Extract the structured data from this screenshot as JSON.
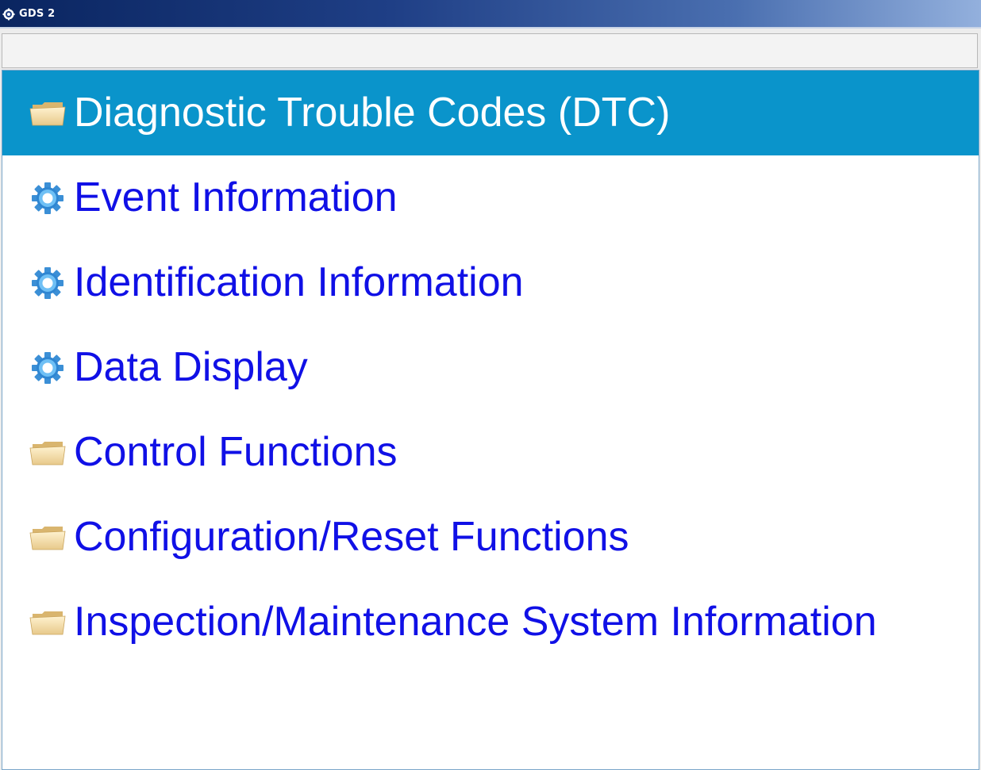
{
  "window": {
    "title": "GDS 2",
    "icon": "gds-app-icon"
  },
  "colors": {
    "selected_background": "#0a94cb",
    "item_text": "#1010e6",
    "selected_text": "#ffffff"
  },
  "menu": {
    "selected_index": 0,
    "items": [
      {
        "label": "Diagnostic Trouble Codes (DTC)",
        "icon": "folder-icon",
        "selected": true
      },
      {
        "label": "Event Information",
        "icon": "gear-icon",
        "selected": false
      },
      {
        "label": "Identification Information",
        "icon": "gear-icon",
        "selected": false
      },
      {
        "label": "Data Display",
        "icon": "gear-icon",
        "selected": false
      },
      {
        "label": "Control Functions",
        "icon": "folder-icon",
        "selected": false
      },
      {
        "label": "Configuration/Reset Functions",
        "icon": "folder-icon",
        "selected": false
      },
      {
        "label": "Inspection/Maintenance System Information",
        "icon": "folder-icon",
        "selected": false
      }
    ]
  }
}
